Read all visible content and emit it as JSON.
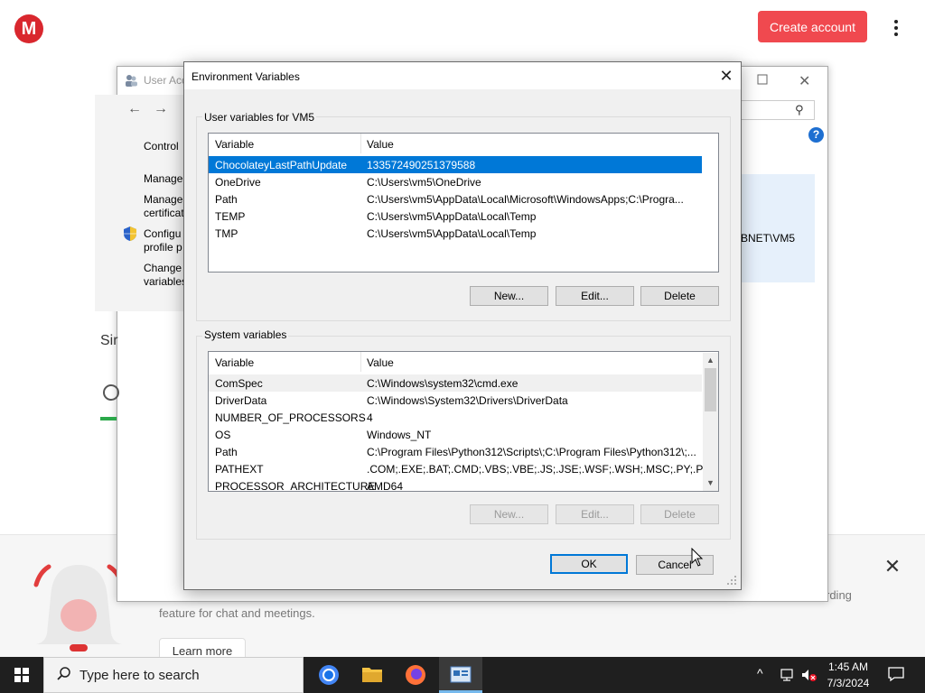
{
  "web": {
    "logo": "M",
    "create_account": "Create account",
    "promo_text": "feature for chat and meetings.",
    "promo_text_right": "rding",
    "learn_more": "Learn more"
  },
  "user_accounts": {
    "title": "User Acc",
    "links": [
      "Control",
      "Manage",
      "Manage",
      "certificat",
      "Configu",
      "profile p",
      "Change",
      "variables"
    ],
    "info_text": "BNET\\VM5",
    "section_heading": "Sir"
  },
  "env": {
    "title": "Environment Variables",
    "user_group_label": "User variables for VM5",
    "system_group_label": "System variables",
    "columns": {
      "variable": "Variable",
      "value": "Value"
    },
    "user_vars": [
      {
        "name": "ChocolateyLastPathUpdate",
        "value": "133572490251379588"
      },
      {
        "name": "OneDrive",
        "value": "C:\\Users\\vm5\\OneDrive"
      },
      {
        "name": "Path",
        "value": "C:\\Users\\vm5\\AppData\\Local\\Microsoft\\WindowsApps;C:\\Progra..."
      },
      {
        "name": "TEMP",
        "value": "C:\\Users\\vm5\\AppData\\Local\\Temp"
      },
      {
        "name": "TMP",
        "value": "C:\\Users\\vm5\\AppData\\Local\\Temp"
      }
    ],
    "system_vars": [
      {
        "name": "ComSpec",
        "value": "C:\\Windows\\system32\\cmd.exe"
      },
      {
        "name": "DriverData",
        "value": "C:\\Windows\\System32\\Drivers\\DriverData"
      },
      {
        "name": "NUMBER_OF_PROCESSORS",
        "value": "4"
      },
      {
        "name": "OS",
        "value": "Windows_NT"
      },
      {
        "name": "Path",
        "value": "C:\\Program Files\\Python312\\Scripts\\;C:\\Program Files\\Python312\\;..."
      },
      {
        "name": "PATHEXT",
        "value": ".COM;.EXE;.BAT;.CMD;.VBS;.VBE;.JS;.JSE;.WSF;.WSH;.MSC;.PY;.PYW"
      },
      {
        "name": "PROCESSOR_ARCHITECTURE",
        "value": "AMD64"
      }
    ],
    "buttons": {
      "new": "New...",
      "edit": "Edit...",
      "delete": "Delete",
      "ok": "OK",
      "cancel": "Cancel"
    }
  },
  "taskbar": {
    "search_placeholder": "Type here to search",
    "time": "1:45 AM",
    "date": "7/3/2024"
  }
}
